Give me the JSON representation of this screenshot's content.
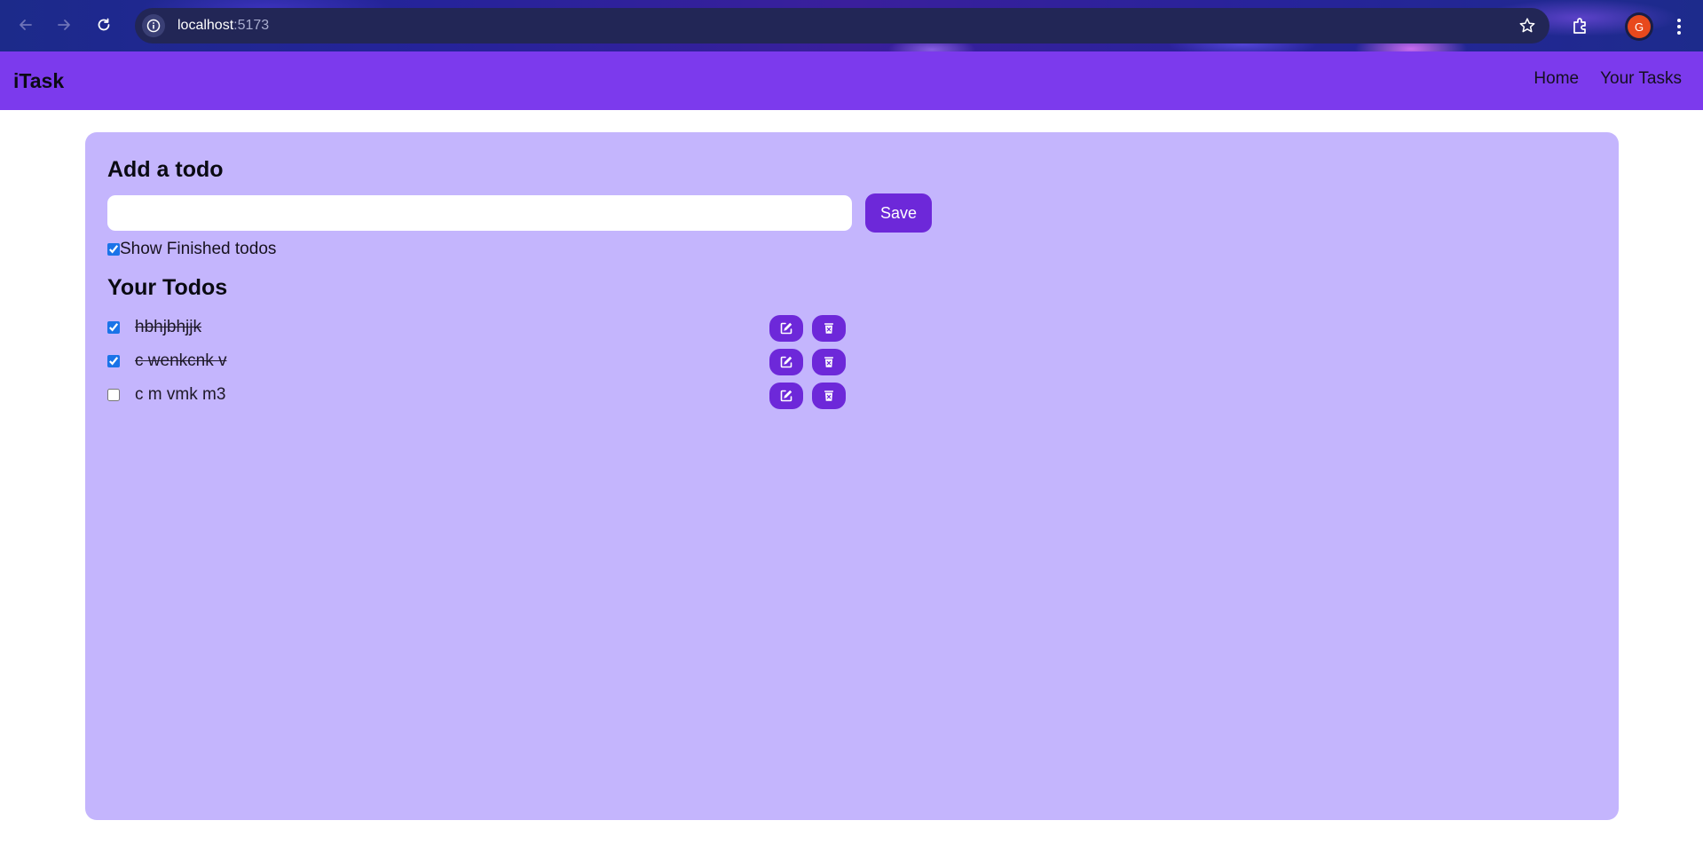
{
  "browser": {
    "url_host": "localhost",
    "url_port": ":5173",
    "avatar_letter": "G",
    "icons": [
      "back-arrow-icon",
      "forward-arrow-icon",
      "reload-icon",
      "site-info-icon",
      "star-icon",
      "extensions-icon",
      "kebab-menu-icon"
    ]
  },
  "navbar": {
    "brand": "iTask",
    "links": [
      "Home",
      "Your Tasks"
    ]
  },
  "add_section": {
    "heading": "Add a todo",
    "input_value": "",
    "save_label": "Save"
  },
  "show_finished": {
    "label": "Show Finished todos",
    "checked": true
  },
  "todos_section": {
    "heading": "Your Todos",
    "items": [
      {
        "text": "hbhjbhjjk",
        "completed": true
      },
      {
        "text": "c wenkcnk v",
        "completed": true
      },
      {
        "text": "c m vmk m3",
        "completed": false
      }
    ],
    "item_icons": [
      "edit-icon",
      "delete-icon"
    ]
  },
  "colors": {
    "navbar_bg": "#7c3aed",
    "card_bg": "#c4b5fd",
    "button_bg": "#6d28d9",
    "avatar_bg": "#e8491d"
  }
}
